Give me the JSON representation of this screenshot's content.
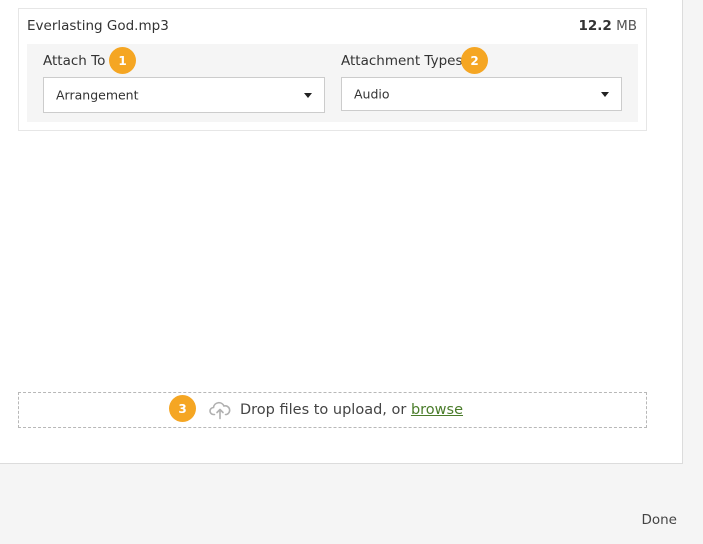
{
  "file": {
    "name": "Everlasting God.mp3",
    "size_value": "12.2",
    "size_unit": "MB"
  },
  "attach_to": {
    "label": "Attach To",
    "badge": "1",
    "value": "Arrangement"
  },
  "attachment_types": {
    "label": "Attachment Types",
    "badge": "2",
    "value": "Audio"
  },
  "dropzone": {
    "badge": "3",
    "text": "Drop files to upload, or ",
    "browse_label": "browse",
    "icon": "cloud-upload-icon"
  },
  "footer": {
    "done_label": "Done"
  },
  "colors": {
    "badge": "#f5a623",
    "link": "#4a7c2a"
  }
}
